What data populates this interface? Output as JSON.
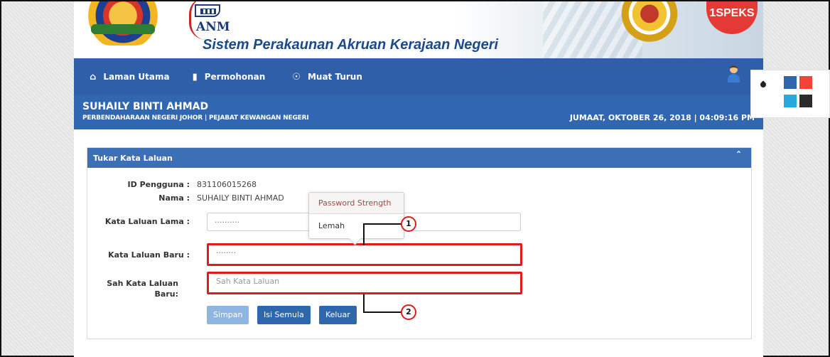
{
  "header": {
    "org_abbr": "ANM",
    "system_title": "Sistem Perakaunan Akruan Kerajaan Negeri",
    "brand": "1SPEKS"
  },
  "nav": {
    "items": [
      {
        "label": "Laman Utama",
        "icon": "home-icon"
      },
      {
        "label": "Permohonan",
        "icon": "book-icon"
      },
      {
        "label": "Muat Turun",
        "icon": "download-icon"
      }
    ],
    "user_icon": "user-icon"
  },
  "user_bar": {
    "name": "SUHAILY BINTI AHMAD",
    "department": "PERBENDAHARAAN NEGERI JOHOR | PEJABAT KEWANGAN NEGERI",
    "datetime": "JUMAAT, OKTOBER 26, 2018 | 04:09:16 PM"
  },
  "panel": {
    "title": "Tukar Kata Laluan",
    "fields": {
      "user_id_label": "ID Pengguna :",
      "user_id_value": "831106015268",
      "name_label": "Nama :",
      "name_value": "SUHAILY BINTI AHMAD",
      "old_pw_label": "Kata Laluan Lama :",
      "old_pw_value": "··········",
      "new_pw_label": "Kata Laluan Baru :",
      "new_pw_value": "········",
      "confirm_pw_label_1": "Sah Kata Laluan",
      "confirm_pw_label_2": "Baru:",
      "confirm_pw_placeholder": "Sah Kata Laluan"
    },
    "buttons": {
      "save": "Simpan",
      "reset": "Isi Semula",
      "exit": "Keluar"
    }
  },
  "password_tooltip": {
    "title": "Password Strength",
    "value": "Lemah"
  },
  "callouts": [
    "1",
    "2"
  ],
  "theme_widget": {
    "icon": "drop-icon",
    "swatches": [
      "#2f67ad",
      "#f44336",
      "#29a8e0",
      "#2b2b2b"
    ]
  }
}
